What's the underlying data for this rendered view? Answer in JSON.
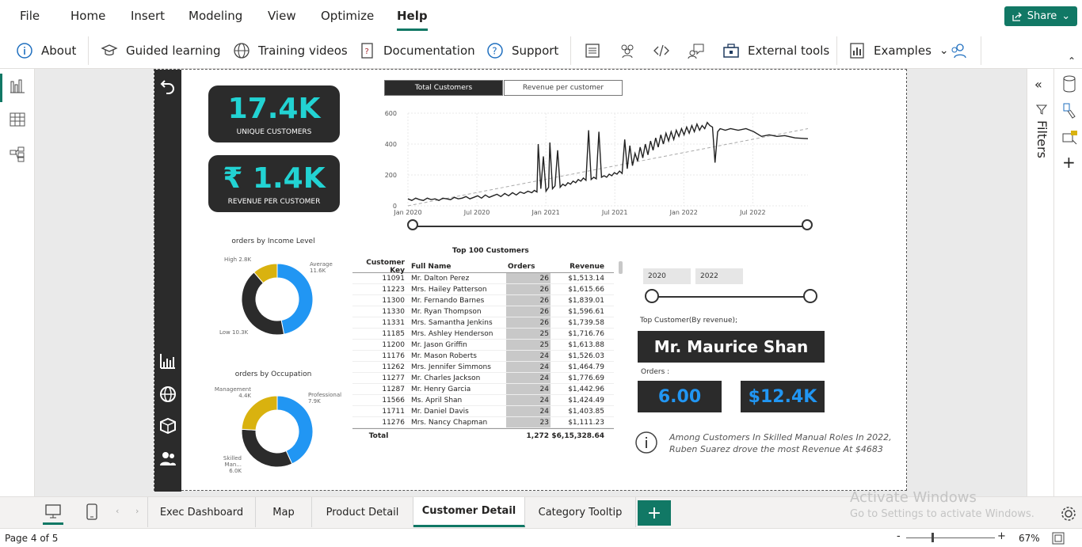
{
  "menu": [
    "File",
    "Home",
    "Insert",
    "Modeling",
    "View",
    "Optimize",
    "Help"
  ],
  "active_menu": "Help",
  "share_label": "Share",
  "ribbon": {
    "about": "About",
    "guided_learning": "Guided learning",
    "training_videos": "Training videos",
    "documentation": "Documentation",
    "support": "Support",
    "external_tools": "External tools",
    "examples": "Examples"
  },
  "kpis": [
    {
      "value": "17.4K",
      "label": "UNIQUE CUSTOMERS"
    },
    {
      "value": "₹ 1.4K",
      "label": "REVENUE PER CUSTOMER"
    }
  ],
  "chart_tabs": [
    "Total Customers",
    "Revenue per customer"
  ],
  "chart_data": [
    {
      "type": "line",
      "y_ticks": [
        "0",
        "200",
        "400",
        "600"
      ],
      "x_ticks": [
        "Jan 2020",
        "Jul 2020",
        "Jan 2021",
        "Jul 2021",
        "Jan 2022",
        "Jul 2022"
      ],
      "ylim": [
        0,
        600
      ],
      "xlim": [
        0,
        31
      ],
      "trendline": [
        [
          0,
          -40
        ],
        [
          31,
          500
        ]
      ],
      "points": [
        [
          0.0,
          45
        ],
        [
          0.3,
          35
        ],
        [
          0.6,
          50
        ],
        [
          0.9,
          40
        ],
        [
          1.2,
          35
        ],
        [
          1.5,
          50
        ],
        [
          1.8,
          40
        ],
        [
          2.1,
          45
        ],
        [
          2.4,
          35
        ],
        [
          2.7,
          50
        ],
        [
          3.0,
          45
        ],
        [
          3.3,
          40
        ],
        [
          3.6,
          55
        ],
        [
          3.9,
          45
        ],
        [
          4.2,
          50
        ],
        [
          4.5,
          60
        ],
        [
          4.8,
          45
        ],
        [
          5.1,
          55
        ],
        [
          5.4,
          65
        ],
        [
          5.7,
          50
        ],
        [
          6.0,
          70
        ],
        [
          6.3,
          55
        ],
        [
          6.6,
          65
        ],
        [
          6.9,
          75
        ],
        [
          7.2,
          60
        ],
        [
          7.5,
          80
        ],
        [
          7.8,
          65
        ],
        [
          8.1,
          85
        ],
        [
          8.4,
          70
        ],
        [
          8.7,
          90
        ],
        [
          9.0,
          80
        ],
        [
          9.3,
          95
        ],
        [
          9.6,
          85
        ],
        [
          9.8,
          100
        ],
        [
          10.0,
          90
        ],
        [
          10.1,
          400
        ],
        [
          10.3,
          110
        ],
        [
          10.5,
          320
        ],
        [
          10.7,
          95
        ],
        [
          10.9,
          120
        ],
        [
          11.0,
          410
        ],
        [
          11.2,
          110
        ],
        [
          11.4,
          130
        ],
        [
          11.6,
          360
        ],
        [
          11.8,
          120
        ],
        [
          12.0,
          140
        ],
        [
          12.2,
          130
        ],
        [
          12.4,
          150
        ],
        [
          12.6,
          140
        ],
        [
          12.8,
          160
        ],
        [
          13.0,
          150
        ],
        [
          13.2,
          170
        ],
        [
          13.4,
          160
        ],
        [
          13.6,
          180
        ],
        [
          13.8,
          165
        ],
        [
          14.0,
          490
        ],
        [
          14.2,
          170
        ],
        [
          14.4,
          185
        ],
        [
          14.6,
          175
        ],
        [
          14.8,
          480
        ],
        [
          15.0,
          185
        ],
        [
          15.2,
          195
        ],
        [
          15.4,
          185
        ],
        [
          15.6,
          205
        ],
        [
          15.8,
          195
        ],
        [
          16.0,
          215
        ],
        [
          16.2,
          205
        ],
        [
          16.4,
          225
        ],
        [
          16.6,
          210
        ],
        [
          16.8,
          430
        ],
        [
          17.0,
          240
        ],
        [
          17.2,
          390
        ],
        [
          17.4,
          260
        ],
        [
          17.6,
          340
        ],
        [
          17.8,
          290
        ],
        [
          18.0,
          380
        ],
        [
          18.2,
          310
        ],
        [
          18.4,
          400
        ],
        [
          18.6,
          330
        ],
        [
          18.8,
          420
        ],
        [
          19.0,
          360
        ],
        [
          19.2,
          440
        ],
        [
          19.4,
          380
        ],
        [
          19.6,
          460
        ],
        [
          19.8,
          400
        ],
        [
          20.0,
          470
        ],
        [
          20.2,
          420
        ],
        [
          20.4,
          480
        ],
        [
          20.6,
          430
        ],
        [
          20.8,
          490
        ],
        [
          21.0,
          450
        ],
        [
          21.2,
          500
        ],
        [
          21.4,
          460
        ],
        [
          21.6,
          510
        ],
        [
          21.8,
          470
        ],
        [
          22.0,
          520
        ],
        [
          22.2,
          480
        ],
        [
          22.4,
          530
        ],
        [
          22.6,
          490
        ],
        [
          22.8,
          520
        ],
        [
          23.0,
          500
        ],
        [
          23.2,
          540
        ],
        [
          23.4,
          520
        ],
        [
          23.6,
          510
        ],
        [
          23.8,
          280
        ],
        [
          24.0,
          480
        ],
        [
          24.2,
          500
        ],
        [
          24.6,
          490
        ],
        [
          25.0,
          500
        ],
        [
          25.6,
          490
        ],
        [
          26.2,
          500
        ],
        [
          26.8,
          480
        ],
        [
          27.4,
          450
        ],
        [
          28.0,
          460
        ],
        [
          28.6,
          450
        ],
        [
          29.2,
          455
        ],
        [
          30.0,
          440
        ],
        [
          31.0,
          435
        ]
      ]
    },
    {
      "type": "pie",
      "title": "orders by Income Level",
      "slices": [
        {
          "label": "Average",
          "value": 11.6,
          "display": "11.6K"
        },
        {
          "label": "Low",
          "value": 10.3,
          "display": "10.3K"
        },
        {
          "label": "High",
          "value": 2.8,
          "display": "2.8K"
        }
      ]
    },
    {
      "type": "pie",
      "title": "orders by Occupation",
      "slices": [
        {
          "label": "Professional",
          "value": 7.9,
          "display": "7.9K"
        },
        {
          "label": "Skilled Man...",
          "value": 6.0,
          "display": "6.0K"
        },
        {
          "label": "Management",
          "value": 4.4,
          "display": "4.4K"
        }
      ]
    }
  ],
  "colors": {
    "accent": "#117865",
    "kpi_value": "#22d3d3",
    "donut_primary": "#2196f3",
    "donut_dark": "#2b2b2b",
    "donut_gold": "#d9b20f"
  },
  "table": {
    "title": "Top 100 Customers",
    "headers": [
      "Customer Key",
      "Full Name",
      "Orders",
      "Revenue"
    ],
    "rows": [
      [
        "11091",
        "Mr. Dalton Perez",
        "26",
        "$1,513.14"
      ],
      [
        "11223",
        "Mrs. Hailey Patterson",
        "26",
        "$1,615.66"
      ],
      [
        "11300",
        "Mr. Fernando Barnes",
        "26",
        "$1,839.01"
      ],
      [
        "11330",
        "Mr. Ryan Thompson",
        "26",
        "$1,596.61"
      ],
      [
        "11331",
        "Mrs. Samantha Jenkins",
        "26",
        "$1,739.58"
      ],
      [
        "11185",
        "Mrs. Ashley Henderson",
        "25",
        "$1,716.76"
      ],
      [
        "11200",
        "Mr. Jason Griffin",
        "25",
        "$1,613.88"
      ],
      [
        "11176",
        "Mr. Mason Roberts",
        "24",
        "$1,526.03"
      ],
      [
        "11262",
        "Mrs. Jennifer Simmons",
        "24",
        "$1,464.79"
      ],
      [
        "11277",
        "Mr. Charles Jackson",
        "24",
        "$1,776.69"
      ],
      [
        "11287",
        "Mr. Henry Garcia",
        "24",
        "$1,442.96"
      ],
      [
        "11566",
        "Ms. April Shan",
        "24",
        "$1,424.49"
      ],
      [
        "11711",
        "Mr. Daniel Davis",
        "24",
        "$1,403.85"
      ],
      [
        "11276",
        "Mrs. Nancy Chapman",
        "23",
        "$1,111.23"
      ]
    ],
    "total": [
      "Total",
      "1,272",
      "$6,15,328.64"
    ]
  },
  "year_slicer": {
    "from": "2020",
    "to": "2022"
  },
  "top_customer": {
    "label": "Top Customer(By revenue);",
    "name": "Mr. Maurice Shan",
    "orders_label": "Orders :",
    "orders_value": "6.00",
    "revenue_value": "$12.4K"
  },
  "insight": "Among Customers In Skilled Manual Roles In 2022, Ruben Suarez drove the most Revenue At $4683",
  "filters_label": "Filters",
  "page_tabs": [
    "Exec Dashboard",
    "Map",
    "Product Detail",
    "Customer Detail",
    "Category Tooltip"
  ],
  "active_page": "Customer Detail",
  "watermark": {
    "line1": "Activate Windows",
    "line2": "Go to Settings to activate Windows."
  },
  "status": {
    "page": "Page 4 of 5",
    "zoom": "67%"
  }
}
